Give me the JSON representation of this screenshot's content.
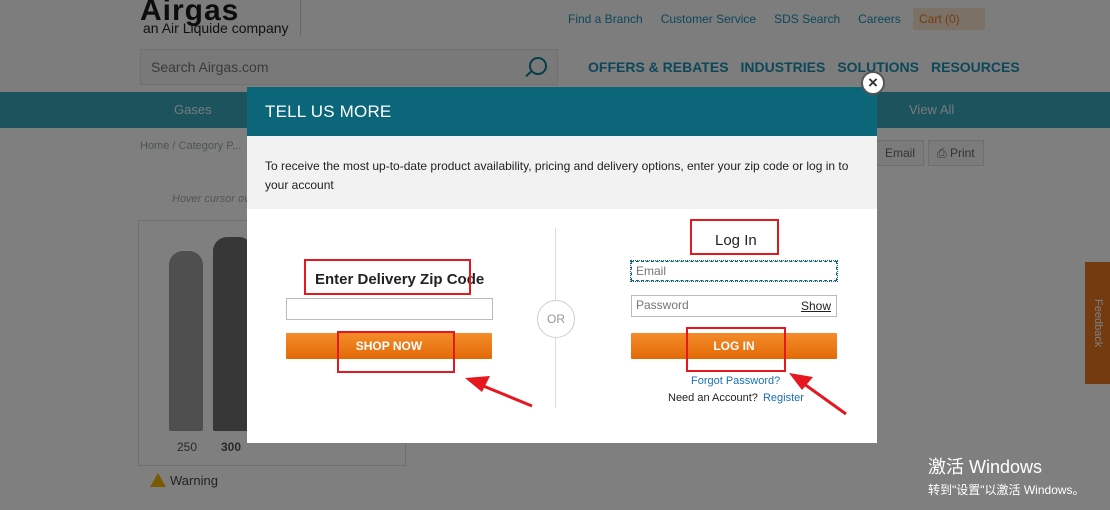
{
  "header": {
    "logo_text": "Airgas",
    "logo_subtext": "an Air Liquide company",
    "top_links": [
      "Find a Branch",
      "Customer Service",
      "SDS Search",
      "Careers"
    ],
    "cart_label": "Cart (0)",
    "search_placeholder": "Search Airgas.com",
    "main_nav": [
      "OFFERS & REBATES",
      "INDUSTRIES",
      "SOLUTIONS",
      "RESOURCES"
    ]
  },
  "category_bar": {
    "items": [
      "Gases",
      "View All"
    ]
  },
  "page": {
    "breadcrumb": "Home / Category P...",
    "email_label": "Email",
    "print_label": "Print",
    "hover_note": "Hover cursor ov...",
    "sizes": [
      "250",
      "300"
    ],
    "warning_label": "Warning",
    "feedback_label": "Feedback"
  },
  "modal": {
    "title": "TELL US MORE",
    "intro": "To receive the most up-to-date product availability, pricing and delivery options, enter your zip code or log in to your account",
    "zip": {
      "label": "Enter Delivery Zip Code",
      "value": "",
      "button_label": "SHOP NOW"
    },
    "or_label": "OR",
    "login": {
      "title": "Log In",
      "email_placeholder": "Email",
      "password_placeholder": "Password",
      "show_label": "Show",
      "button_label": "LOG IN",
      "forgot_label": "Forgot Password?",
      "need_account_label": "Need an Account?",
      "register_label": "Register"
    },
    "close_icon": "×"
  },
  "watermark": {
    "title": "激活 Windows",
    "subtitle": "转到\"设置\"以激活 Windows。"
  },
  "colors": {
    "modal_header": "#0b6679",
    "button_orange": "#e87722",
    "annotation_red": "#e5171f",
    "link_blue": "#1a6fb5"
  }
}
